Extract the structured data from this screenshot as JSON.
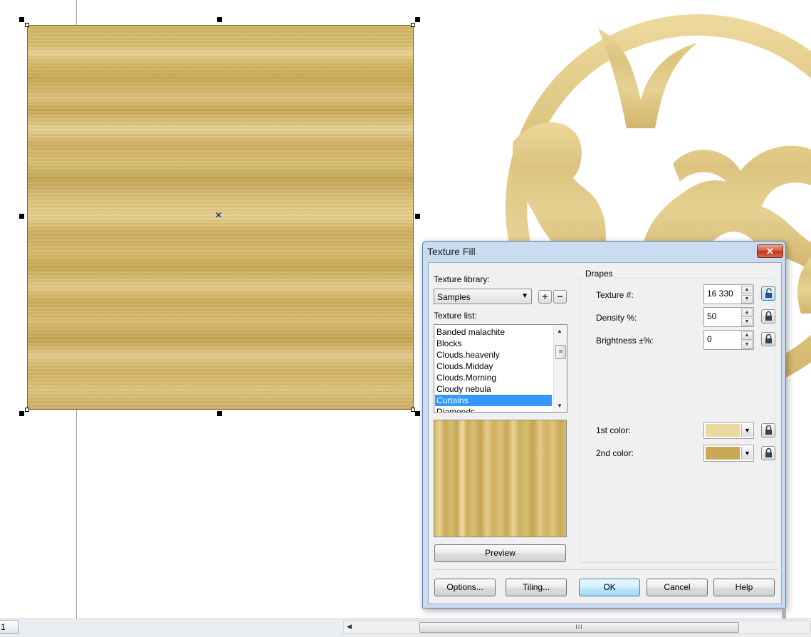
{
  "dialog": {
    "title": "Texture Fill",
    "close_label": "✕",
    "library_label": "Texture library:",
    "library_value": "Samples",
    "list_label": "Texture list:",
    "textures": [
      "Banded malachite",
      "Blocks",
      "Clouds.heavenly",
      "Clouds.Midday",
      "Clouds.Morning",
      "Cloudy nebula",
      "Curtains",
      "Diamonds"
    ],
    "selected_texture": "Curtains",
    "preview_label": "Preview",
    "group_label": "Drapes",
    "params": {
      "texture_num_label": "Texture #:",
      "texture_num_value": "16 330",
      "density_label": "Density %:",
      "density_value": "50",
      "brightness_label": "Brightness ±%:",
      "brightness_value": "0"
    },
    "colors": {
      "first_label": "1st color:",
      "first_hex": "#ecd99d",
      "second_label": "2nd color:",
      "second_hex": "#c9a955"
    },
    "buttons": {
      "options": "Options...",
      "tiling": "Tiling...",
      "ok": "OK",
      "cancel": "Cancel",
      "help": "Help"
    }
  },
  "statusbar": {
    "page_number": "1"
  }
}
